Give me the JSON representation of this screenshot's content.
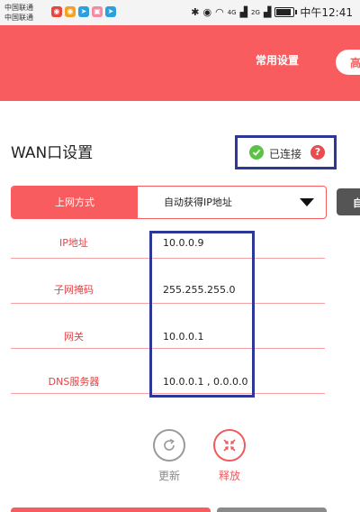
{
  "status_bar": {
    "carrier_1": "中国联通",
    "carrier_2": "中国联通",
    "network_1": "4G",
    "network_2": "2G",
    "battery_level": 0.8,
    "time": "中午12:41"
  },
  "header": {
    "tab_common": "常用设置",
    "tab_advanced": "高"
  },
  "wan": {
    "title": "WAN口设置",
    "status_text": "已连接",
    "help_label": "?"
  },
  "connection": {
    "label": "上网方式",
    "value": "自动获得IP地址",
    "side_button": "自"
  },
  "info_rows": [
    {
      "label": "IP地址",
      "value": "10.0.0.9"
    },
    {
      "label": "子网掩码",
      "value": "255.255.255.0"
    },
    {
      "label": "网关",
      "value": "10.0.0.1"
    },
    {
      "label": "DNS服务器",
      "value": "10.0.0.1 , 0.0.0.0"
    }
  ],
  "actions": {
    "refresh_label": "更新",
    "release_label": "释放"
  },
  "colors": {
    "accent": "#f95c5e",
    "highlight_box": "#2d3796",
    "connected": "#5cc244"
  }
}
